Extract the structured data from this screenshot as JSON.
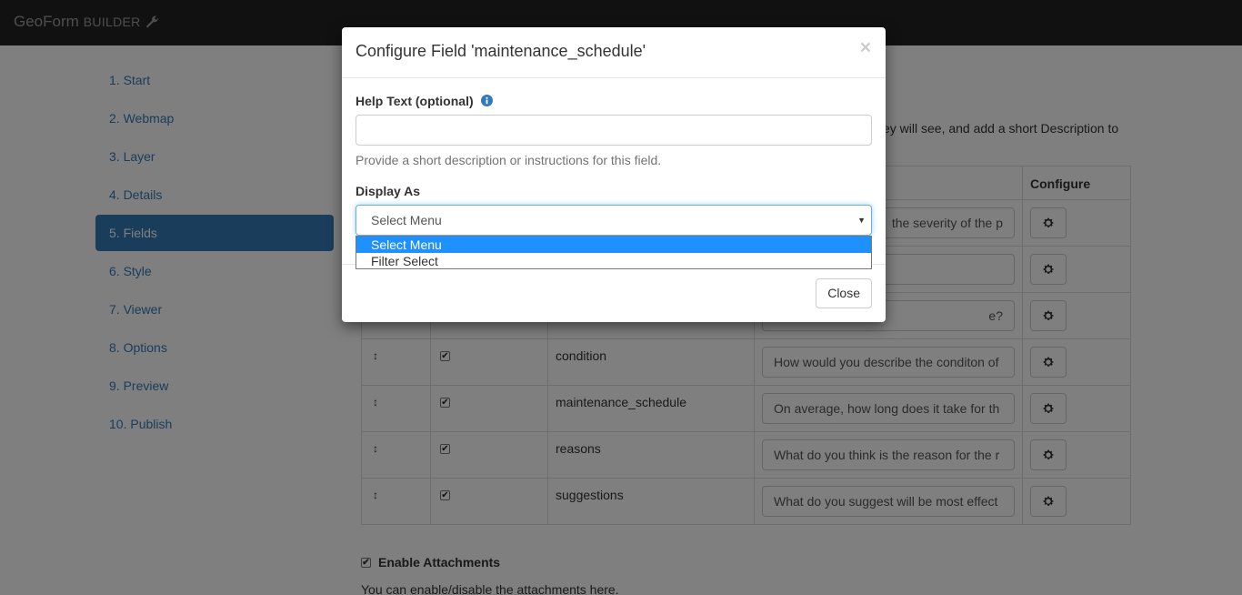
{
  "app": {
    "brand_name": "GeoForm",
    "brand_suffix": "BUILDER",
    "brand_icon": "wrench-icon"
  },
  "sidebar": {
    "items": [
      {
        "label": "1. Start"
      },
      {
        "label": "2. Webmap"
      },
      {
        "label": "3. Layer"
      },
      {
        "label": "4. Details"
      },
      {
        "label": "5. Fields",
        "active": true
      },
      {
        "label": "6. Style"
      },
      {
        "label": "7. Viewer"
      },
      {
        "label": "8. Options"
      },
      {
        "label": "9. Preview"
      },
      {
        "label": "10. Publish"
      }
    ]
  },
  "main": {
    "description_fragment": "ey will see, and add a short Description to",
    "table": {
      "configure_header": "Configure",
      "partial_rows": [
        {
          "description": "the severity of the p"
        },
        {
          "description": ""
        },
        {
          "description": "e?"
        }
      ],
      "rows": [
        {
          "name": "condition",
          "checked": true,
          "description": "How would you describe the conditon of"
        },
        {
          "name": "maintenance_schedule",
          "checked": true,
          "description": "On average, how long does it take for th"
        },
        {
          "name": "reasons",
          "checked": true,
          "description": "What do you think is the reason for the r"
        },
        {
          "name": "suggestions",
          "checked": true,
          "description": "What do you suggest will be most effect"
        }
      ]
    },
    "attachments": {
      "label": "Enable Attachments",
      "checked": true,
      "note": "You can enable/disable the attachments here."
    }
  },
  "modal": {
    "title": "Configure Field 'maintenance_schedule'",
    "close_glyph": "×",
    "help_text_label": "Help Text (optional)",
    "help_text_value": "",
    "help_block": "Provide a short description or instructions for this field.",
    "display_as_label": "Display As",
    "display_as_value": "Select Menu",
    "options": [
      {
        "label": "Select Menu",
        "selected": true
      },
      {
        "label": "Filter Select",
        "selected": false
      }
    ],
    "close_button": "Close"
  },
  "colors": {
    "topbar": "#222222",
    "accent": "#337ab7",
    "option_highlight": "#1e90ff"
  }
}
